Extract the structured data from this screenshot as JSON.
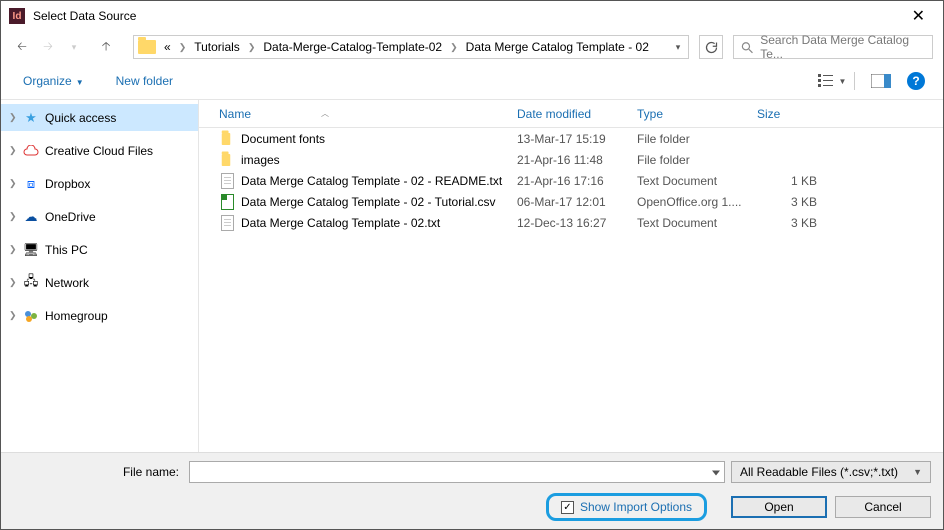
{
  "window": {
    "title": "Select Data Source"
  },
  "breadcrumb": {
    "ellipsis": "«",
    "items": [
      "Tutorials",
      "Data-Merge-Catalog-Template-02",
      "Data Merge Catalog Template - 02"
    ]
  },
  "search": {
    "placeholder": "Search Data Merge Catalog Te..."
  },
  "toolbar": {
    "organize": "Organize",
    "newfolder": "New folder"
  },
  "sidebar": {
    "items": [
      {
        "label": "Quick access"
      },
      {
        "label": "Creative Cloud Files"
      },
      {
        "label": "Dropbox"
      },
      {
        "label": "OneDrive"
      },
      {
        "label": "This PC"
      },
      {
        "label": "Network"
      },
      {
        "label": "Homegroup"
      }
    ]
  },
  "columns": {
    "name": "Name",
    "date": "Date modified",
    "type": "Type",
    "size": "Size"
  },
  "files": [
    {
      "name": "Document fonts",
      "date": "13-Mar-17 15:19",
      "type": "File folder",
      "size": "",
      "kind": "folder"
    },
    {
      "name": "images",
      "date": "21-Apr-16 11:48",
      "type": "File folder",
      "size": "",
      "kind": "folder"
    },
    {
      "name": "Data Merge Catalog Template - 02 - README.txt",
      "date": "21-Apr-16 17:16",
      "type": "Text Document",
      "size": "1 KB",
      "kind": "txt"
    },
    {
      "name": "Data Merge Catalog Template - 02 - Tutorial.csv",
      "date": "06-Mar-17 12:01",
      "type": "OpenOffice.org 1....",
      "size": "3 KB",
      "kind": "csv"
    },
    {
      "name": "Data Merge Catalog Template - 02.txt",
      "date": "12-Dec-13 16:27",
      "type": "Text Document",
      "size": "3 KB",
      "kind": "txt"
    }
  ],
  "footer": {
    "fname_label": "File name:",
    "fname_value": "",
    "filter": "All Readable Files (*.csv;*.txt)",
    "import_options": "Show Import Options",
    "open": "Open",
    "cancel": "Cancel"
  }
}
